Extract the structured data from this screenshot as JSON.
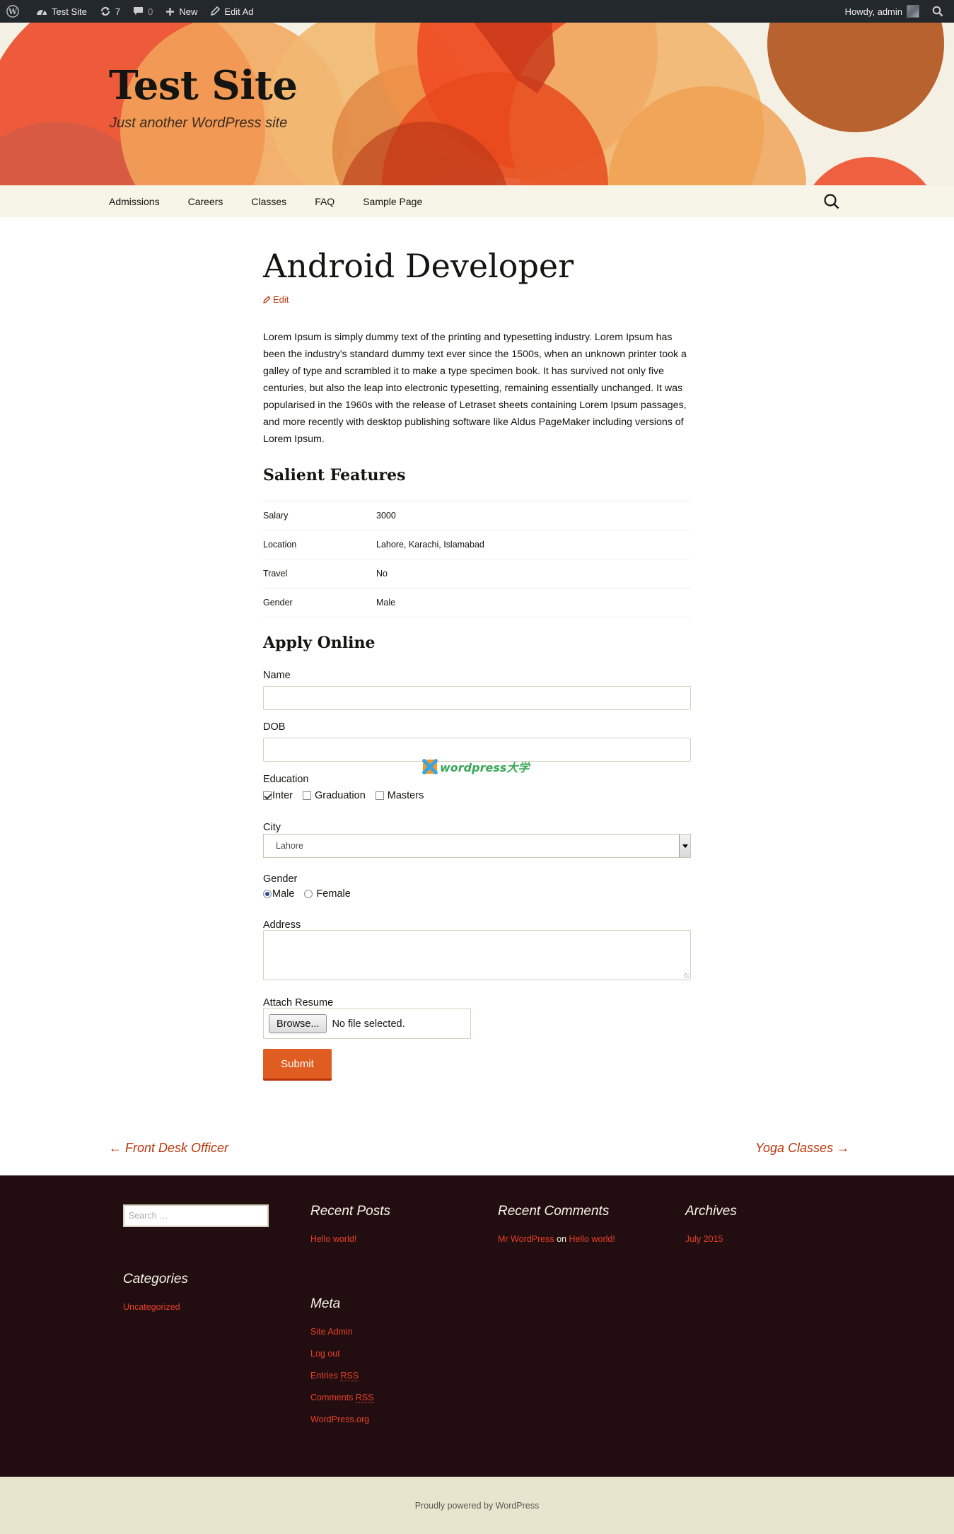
{
  "adminbar": {
    "site_name": "Test Site",
    "updates_count": "7",
    "comments_count": "0",
    "new_label": "New",
    "edit_label": "Edit Ad",
    "howdy": "Howdy, admin"
  },
  "header": {
    "title": "Test Site",
    "description": "Just another WordPress site"
  },
  "nav": {
    "items": [
      "Admissions",
      "Careers",
      "Classes",
      "FAQ",
      "Sample Page"
    ]
  },
  "post": {
    "title": "Android Developer",
    "edit": "Edit",
    "intro": "Lorem Ipsum is simply dummy text of the printing and typesetting industry. Lorem Ipsum has been the industry's standard dummy text ever since the 1500s, when an unknown printer took a galley of type and scrambled it to make a type specimen book. It has survived not only five centuries, but also the leap into electronic typesetting, remaining essentially unchanged. It was popularised in the 1960s with the release of Letraset sheets containing Lorem Ipsum passages, and more recently with desktop publishing software like Aldus PageMaker including versions of Lorem Ipsum.",
    "features_heading": "Salient Features",
    "features": [
      {
        "key": "Salary",
        "value": "3000"
      },
      {
        "key": "Location",
        "value": "Lahore, Karachi, Islamabad"
      },
      {
        "key": "Travel",
        "value": "No"
      },
      {
        "key": "Gender",
        "value": "Male"
      }
    ]
  },
  "form": {
    "heading": "Apply Online",
    "name_label": "Name",
    "dob_label": "DOB",
    "education_label": "Education",
    "education_options": [
      {
        "label": "Inter",
        "checked": true
      },
      {
        "label": "Graduation",
        "checked": false
      },
      {
        "label": "Masters",
        "checked": false
      }
    ],
    "city_label": "City",
    "city_value": "Lahore",
    "gender_label": "Gender",
    "gender_options": [
      {
        "label": "Male",
        "checked": true
      },
      {
        "label": "Female",
        "checked": false
      }
    ],
    "address_label": "Address",
    "resume_label": "Attach Resume",
    "browse_label": "Browse...",
    "file_status": "No file selected.",
    "submit_label": "Submit"
  },
  "watermark": "wordpress大学",
  "post_nav": {
    "prev": "← Front Desk Officer",
    "next": "Yoga Classes →"
  },
  "footer": {
    "search_placeholder": "Search …",
    "recent_posts_title": "Recent Posts",
    "recent_posts": [
      "Hello world!"
    ],
    "recent_comments_title": "Recent Comments",
    "recent_comment": {
      "author": "Mr WordPress",
      "on": "on",
      "post": "Hello world!"
    },
    "archives_title": "Archives",
    "archives": [
      "July 2015"
    ],
    "categories_title": "Categories",
    "categories": [
      "Uncategorized"
    ],
    "meta_title": "Meta",
    "meta": {
      "site_admin": "Site Admin",
      "log_out": "Log out",
      "entries_prefix": "Entries ",
      "comments_prefix": "Comments ",
      "rss": "RSS",
      "wordpress_org": "WordPress.org"
    },
    "credit": "Proudly powered by WordPress"
  },
  "colors": {
    "accent": "#bc360a",
    "button": "#e05d22",
    "footer_bg": "#220e10",
    "link_footer": "#e63f2a"
  }
}
